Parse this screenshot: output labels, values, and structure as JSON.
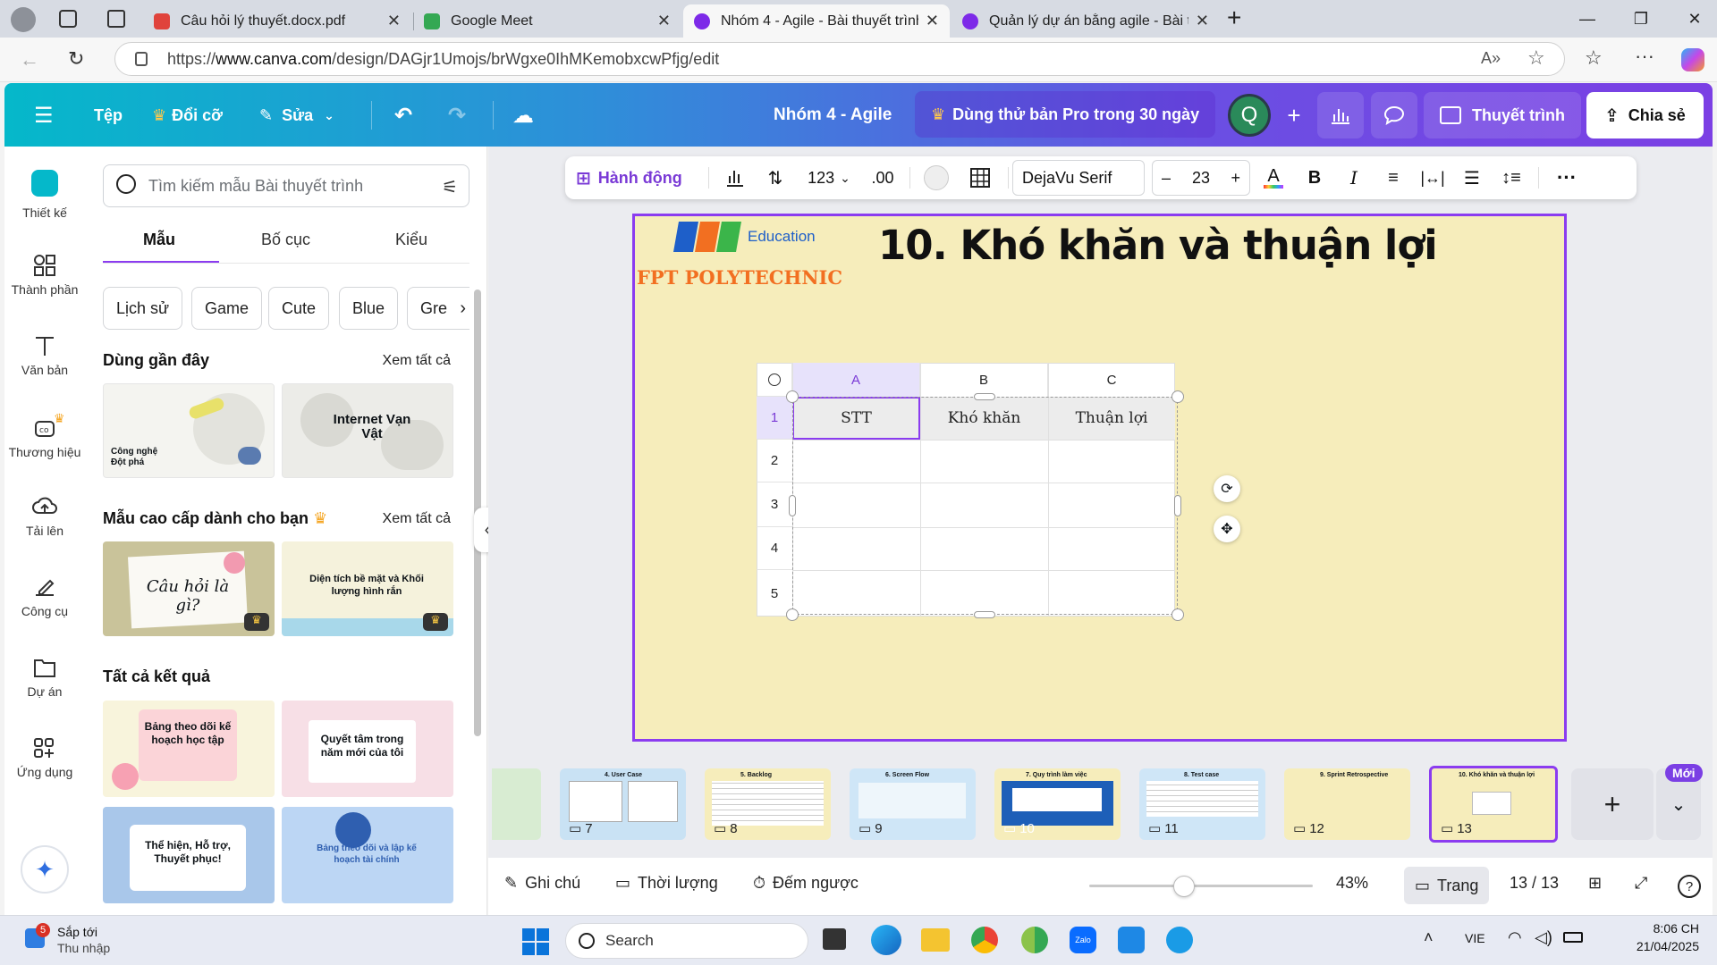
{
  "browser": {
    "tabs": [
      {
        "title": "Câu hỏi lý thuyết.docx.pdf",
        "active": false
      },
      {
        "title": "Google Meet",
        "active": false
      },
      {
        "title": "Nhóm 4 - Agile - Bài thuyết trình",
        "active": true
      },
      {
        "title": "Quản lý dự án bằng agile - Bài thu",
        "active": false
      }
    ],
    "url_prefix": "https://",
    "url_domain": "www.canva.com",
    "url_path": "/design/DAGjr1Umojs/brWgxe0IhMKemobxcwPfjg/edit"
  },
  "header": {
    "file": "Tệp",
    "resize": "Đổi cỡ",
    "edit": "Sửa",
    "title": "Nhóm 4 - Agile",
    "pro_trial": "Dùng thử bản Pro trong 30 ngày",
    "avatar_letter": "Q",
    "present": "Thuyết trình",
    "share": "Chia sẻ"
  },
  "rail": [
    {
      "label": "Thiết kế",
      "icon": "design-icon"
    },
    {
      "label": "Thành phần",
      "icon": "elements-icon"
    },
    {
      "label": "Văn bản",
      "icon": "text-icon"
    },
    {
      "label": "Thương hiệu",
      "icon": "brand-icon"
    },
    {
      "label": "Tải lên",
      "icon": "upload-icon"
    },
    {
      "label": "Công cụ",
      "icon": "tools-icon"
    },
    {
      "label": "Dự án",
      "icon": "projects-icon"
    },
    {
      "label": "Ứng dụng",
      "icon": "apps-icon"
    }
  ],
  "panel": {
    "search_placeholder": "Tìm kiếm mẫu Bài thuyết trình",
    "tabs": [
      "Mẫu",
      "Bố cục",
      "Kiểu"
    ],
    "chips": [
      "Lịch sử",
      "Game",
      "Cute",
      "Blue",
      "Gre"
    ],
    "recent_heading": "Dùng gần đây",
    "see_all": "Xem tất cả",
    "premium_heading": "Mẫu cao cấp dành cho bạn",
    "all_results_heading": "Tất cả kết quả",
    "recent": [
      {
        "title": "Công nghệ Đột phá"
      },
      {
        "title": "Internet Vạn Vật"
      }
    ],
    "premium": [
      {
        "title": "Câu hỏi là gì?"
      },
      {
        "title": "Diện tích bề mặt và Khối lượng hình rắn"
      }
    ],
    "results": [
      {
        "title": "Bảng theo dõi kế hoạch học tập"
      },
      {
        "title": "Quyết tâm trong năm mới của tôi"
      },
      {
        "title": "Thể hiện, Hỗ trợ, Thuyết phục!"
      },
      {
        "title": "Bảng theo dõi và lập kế hoạch tài chính"
      }
    ]
  },
  "toolbar": {
    "action": "Hành động",
    "number_format": "123",
    "decimals": ".00",
    "font": "DejaVu Serif",
    "font_size": "23"
  },
  "slide": {
    "logo_sub": "Education",
    "school": "FPT POLYTECHNIC",
    "title": "10. Khó khăn và thuận lợi",
    "table": {
      "col_headers": [
        "A",
        "B",
        "C"
      ],
      "row_numbers": [
        "1",
        "2",
        "3",
        "4",
        "5"
      ],
      "rows": [
        [
          "STT",
          "Khó khăn",
          "Thuận lợi"
        ],
        [
          "",
          "",
          ""
        ],
        [
          "",
          "",
          ""
        ],
        [
          "",
          "",
          ""
        ],
        [
          "",
          "",
          ""
        ]
      ]
    }
  },
  "pages": [
    {
      "num": "7",
      "caption": "4. User Case"
    },
    {
      "num": "8",
      "caption": "5. Backlog"
    },
    {
      "num": "9",
      "caption": "6. Screen Flow"
    },
    {
      "num": "10",
      "caption": "7. Quy trình làm việc"
    },
    {
      "num": "11",
      "caption": "8. Test case"
    },
    {
      "num": "12",
      "caption": "9. Sprint Retrospective"
    },
    {
      "num": "13",
      "caption": "10. Khó khăn và thuận lợi"
    }
  ],
  "new_badge": "Mới",
  "footer": {
    "notes": "Ghi chú",
    "duration": "Thời lượng",
    "timer": "Đếm ngược",
    "zoom": "43%",
    "page_view": "Trang",
    "page_counter": "13 / 13"
  },
  "taskbar": {
    "weather_badge": "5",
    "widget_title": "Sắp tới",
    "widget_sub": "Thu nhập",
    "search": "Search",
    "lang": "VIE",
    "time": "8:06 CH",
    "date": "21/04/2025"
  },
  "colors": {
    "accent_purple": "#8b3cf0",
    "slide_bg": "#f6edbb",
    "header_start": "#05b8ca",
    "header_end": "#7b3fe4"
  }
}
